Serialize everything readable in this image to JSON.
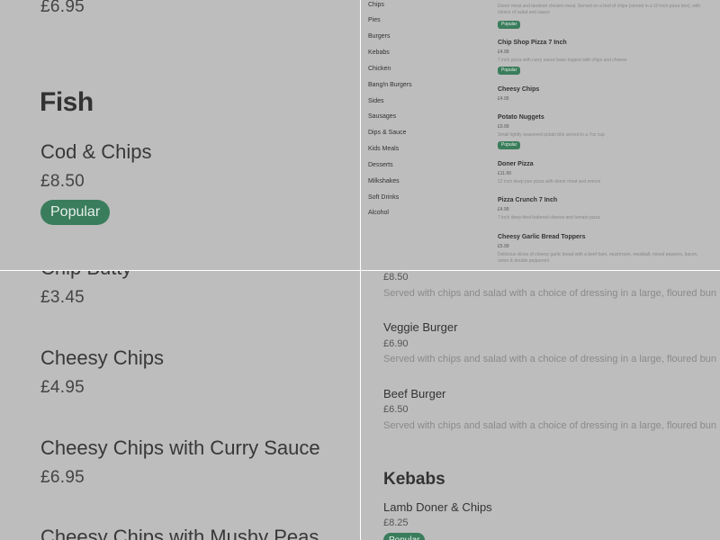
{
  "top_left": {
    "price_top": "£6.95",
    "section_heading": "Fish",
    "item": {
      "name": "Cod & Chips",
      "price": "£8.50",
      "badge": "Popular"
    }
  },
  "top_right": {
    "categories": [
      "Chips",
      "Pies",
      "Burgers",
      "Kebabs",
      "Chicken",
      "Bang!n Burgers",
      "Sides",
      "Sausages",
      "Dips & Sauce",
      "Kids Meals",
      "Desserts",
      "Milkshakes",
      "Soft Drinks",
      "Alcohol"
    ],
    "first_item_desc": "Doner meat and tandoori chicken meat. Served on a bed of chips (served in a 10 inch pizza box), with choice of salad and sauce",
    "first_item_badge": "Popular",
    "items": [
      {
        "name": "Chip Shop Pizza 7 Inch",
        "price": "£4.99",
        "desc": "7 inch pizza with curry sauce base topped with chips and cheese",
        "badge": "Popular"
      },
      {
        "name": "Cheesy Chips",
        "price": "£4.95",
        "desc": "",
        "badge": ""
      },
      {
        "name": "Potato Nuggets",
        "price": "£0.99",
        "desc": "Small lightly seasoned potato bits served in a 7oz cup",
        "badge": "Popular"
      },
      {
        "name": "Doner Pizza",
        "price": "£11.99",
        "desc": "12 inch deep pan pizza with doner meat and onions",
        "badge": ""
      },
      {
        "name": "Pizza Crunch 7 Inch",
        "price": "£4.99",
        "desc": "7 inch deep fried battered cheese and tomato pizza",
        "badge": ""
      },
      {
        "name": "Cheesy Garlic Bread Toppers",
        "price": "£5.99",
        "desc": "Delicious slices of cheesy garlic bread with a beef ham, mushroom, meatball, mixed peppers, bacon, onion & double pepperoni",
        "badge": ""
      }
    ]
  },
  "bottom_left": {
    "partial_item": {
      "name": "Chip Butty",
      "price": "£3.45"
    },
    "items": [
      {
        "name": "Cheesy Chips",
        "price": "£4.95"
      },
      {
        "name": "Cheesy Chips with Curry Sauce",
        "price": "£6.95"
      },
      {
        "name": "Cheesy Chips with Mushy Peas",
        "price": ""
      }
    ]
  },
  "bottom_right": {
    "partial_price": "£8.50",
    "partial_desc": "Served with chips and salad with a choice of dressing in a large, floured bun",
    "items": [
      {
        "name": "Veggie Burger",
        "price": "£6.90",
        "desc": "Served with chips and salad with a choice of dressing in a large, floured bun"
      },
      {
        "name": "Beef Burger",
        "price": "£6.50",
        "desc": "Served with chips and salad with a choice of dressing in a large, floured bun"
      }
    ],
    "section_heading": "Kebabs",
    "kebab_item": {
      "name": "Lamb Doner & Chips",
      "price": "£8.25",
      "badge": "Popular"
    }
  },
  "colors": {
    "background": "#bdbdbd",
    "badge": "#3a7d5c",
    "divider": "#ffffff"
  }
}
